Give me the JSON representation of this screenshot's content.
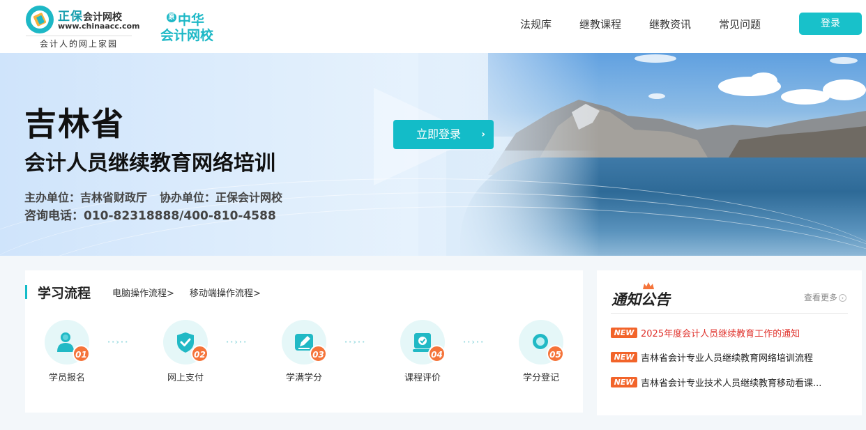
{
  "header": {
    "brand": "正保",
    "brand_sub": "会计网校",
    "url": "www.chinaacc.com",
    "slogan": "会计人的网上家园",
    "sublogo_mark": "原",
    "sublogo_line1": "中华",
    "sublogo_line2": "会计网校",
    "nav": [
      "法规库",
      "继教课程",
      "继教资讯",
      "常见问题"
    ],
    "login_label": "登录"
  },
  "banner": {
    "title": "吉林省",
    "subtitle": "会计人员继续教育网络培训",
    "host": "主办单位：吉林省财政厅",
    "co_host": "协办单位：正保会计网校",
    "phone": "咨询电话：010-82318888/400-810-4588",
    "cta_label": "立即登录",
    "cta_arrow": "›"
  },
  "process": {
    "title": "学习流程",
    "links": [
      "电脑操作流程>",
      "移动端操作流程>"
    ],
    "steps": [
      {
        "num": "01",
        "label": "学员报名",
        "icon": "user-icon"
      },
      {
        "num": "02",
        "label": "网上支付",
        "icon": "shield-check-icon"
      },
      {
        "num": "03",
        "label": "学满学分",
        "icon": "edit-icon"
      },
      {
        "num": "04",
        "label": "课程评价",
        "icon": "certificate-icon"
      },
      {
        "num": "05",
        "label": "学分登记",
        "icon": "search-icon"
      }
    ],
    "arrow_glyph": "··›··",
    "accent": "#13bcc8",
    "badge_color": "#f5743a"
  },
  "notice": {
    "title": "通知公告",
    "more_label": "查看更多",
    "more_icon": "›",
    "badge": "NEW",
    "items": [
      "2025年度会计人员继续教育工作的通知",
      "吉林省会计专业人员继续教育网络培训流程",
      "吉林省会计专业技术人员继续教育移动看课..."
    ]
  }
}
